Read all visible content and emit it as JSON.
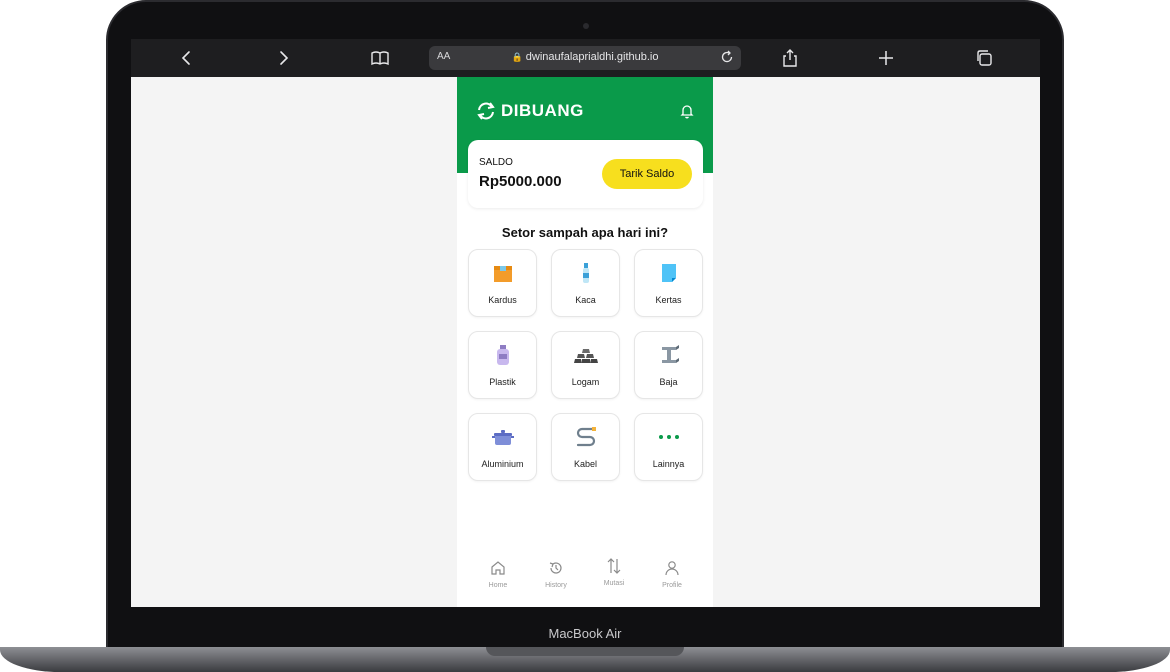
{
  "device": {
    "label": "MacBook Air"
  },
  "browser": {
    "aa_label": "AA",
    "url": "dwinaufalaprialdhi.github.io"
  },
  "app": {
    "brand": "DIBUANG",
    "brand_color": "#0a9a4a",
    "saldo": {
      "label": "SALDO",
      "value": "Rp5000.000",
      "button_label": "Tarik Saldo",
      "button_color": "#f7df1e"
    },
    "section_title": "Setor sampah apa hari ini?",
    "categories": [
      {
        "label": "Kardus",
        "icon": "box-icon"
      },
      {
        "label": "Kaca",
        "icon": "glass-bottle-icon"
      },
      {
        "label": "Kertas",
        "icon": "paper-icon"
      },
      {
        "label": "Plastik",
        "icon": "plastic-bottle-icon"
      },
      {
        "label": "Logam",
        "icon": "metal-bars-icon"
      },
      {
        "label": "Baja",
        "icon": "steel-beam-icon"
      },
      {
        "label": "Aluminium",
        "icon": "pot-icon"
      },
      {
        "label": "Kabel",
        "icon": "cable-icon"
      },
      {
        "label": "Lainnya",
        "icon": "more-dots-icon"
      }
    ],
    "nav": [
      {
        "label": "Home",
        "icon": "home-icon"
      },
      {
        "label": "History",
        "icon": "history-icon"
      },
      {
        "label": "Mutasi",
        "icon": "transfer-arrows-icon"
      },
      {
        "label": "Profile",
        "icon": "user-icon"
      }
    ]
  }
}
